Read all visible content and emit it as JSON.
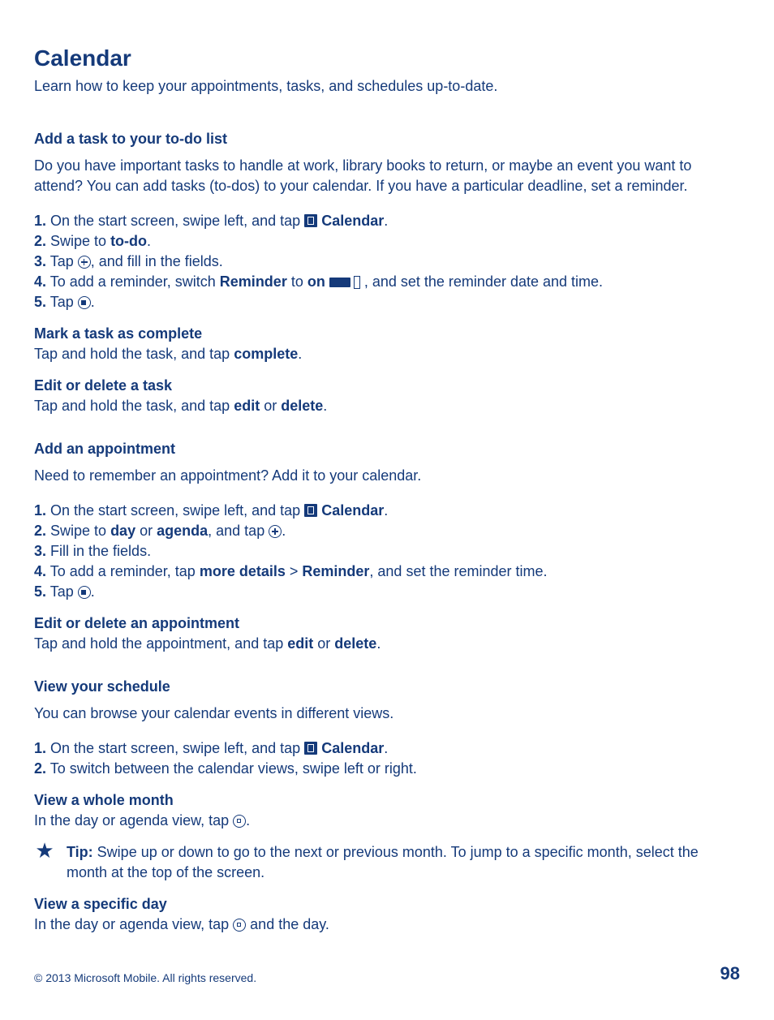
{
  "page_title": "Calendar",
  "intro": "Learn how to keep your appointments, tasks, and schedules up-to-date.",
  "sections": {
    "add_task": {
      "heading": "Add a task to your to-do list",
      "lead": "Do you have important tasks to handle at work, library books to return, or maybe an event you want to attend? You can add tasks (to-dos) to your calendar. If you have a particular deadline, set a reminder.",
      "step1_prefix": "1.",
      "step1_text": " On the start screen, swipe left, and tap ",
      "step1_bold": "Calendar",
      "step1_suffix": ".",
      "step2_prefix": "2.",
      "step2_text": " Swipe to ",
      "step2_bold": "to-do",
      "step2_suffix": ".",
      "step3_prefix": "3.",
      "step3_text": " Tap ",
      "step3_suffix": ", and fill in the fields.",
      "step4_prefix": "4.",
      "step4_text": " To add a reminder, switch ",
      "step4_bold1": "Reminder",
      "step4_mid": " to ",
      "step4_bold2": "on",
      "step4_suffix": " , and set the reminder date and time.",
      "step5_prefix": "5.",
      "step5_text": " Tap ",
      "step5_suffix": ".",
      "sub_complete_heading": "Mark a task as complete",
      "sub_complete_text1": "Tap and hold the task, and tap ",
      "sub_complete_bold": "complete",
      "sub_complete_suffix": ".",
      "sub_edit_heading": "Edit or delete a task",
      "sub_edit_text1": "Tap and hold the task, and tap ",
      "sub_edit_bold1": "edit",
      "sub_edit_mid": " or ",
      "sub_edit_bold2": "delete",
      "sub_edit_suffix": "."
    },
    "add_appt": {
      "heading": "Add an appointment",
      "lead": "Need to remember an appointment? Add it to your calendar.",
      "step1_prefix": "1.",
      "step1_text": " On the start screen, swipe left, and tap ",
      "step1_bold": "Calendar",
      "step1_suffix": ".",
      "step2_prefix": "2.",
      "step2_text": " Swipe to ",
      "step2_bold1": "day",
      "step2_mid": " or ",
      "step2_bold2": "agenda",
      "step2_mid2": ", and tap ",
      "step2_suffix": ".",
      "step3_prefix": "3.",
      "step3_text": " Fill in the fields.",
      "step4_prefix": "4.",
      "step4_text": " To add a reminder, tap ",
      "step4_bold1": "more details",
      "step4_mid": " > ",
      "step4_bold2": "Reminder",
      "step4_suffix": ", and set the reminder time.",
      "step5_prefix": "5.",
      "step5_text": " Tap ",
      "step5_suffix": ".",
      "sub_edit_heading": "Edit or delete an appointment",
      "sub_edit_text1": "Tap and hold the appointment, and tap ",
      "sub_edit_bold1": "edit",
      "sub_edit_mid": " or ",
      "sub_edit_bold2": "delete",
      "sub_edit_suffix": "."
    },
    "view_schedule": {
      "heading": "View your schedule",
      "lead": "You can browse your calendar events in different views.",
      "step1_prefix": "1.",
      "step1_text": " On the start screen, swipe left, and tap ",
      "step1_bold": "Calendar",
      "step1_suffix": ".",
      "step2_prefix": "2.",
      "step2_text": " To switch between the calendar views, swipe left or right.",
      "sub_month_heading": "View a whole month",
      "sub_month_text1": "In the day or agenda view, tap ",
      "sub_month_suffix": ".",
      "tip_label": "Tip:",
      "tip_text": " Swipe up or down to go to the next or previous month. To jump to a specific month, select the month at the top of the screen.",
      "sub_day_heading": "View a specific day",
      "sub_day_text1": "In the day or agenda view, tap ",
      "sub_day_suffix": " and the day."
    }
  },
  "footer": {
    "copyright": "© 2013 Microsoft Mobile. All rights reserved.",
    "page_number": "98"
  }
}
